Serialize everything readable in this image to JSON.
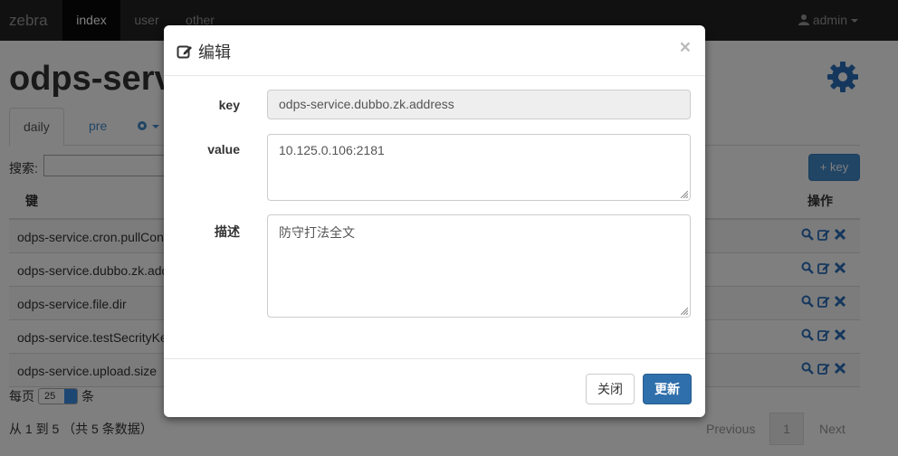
{
  "navbar": {
    "brand": "zebra",
    "items": [
      {
        "label": "index",
        "active": true
      },
      {
        "label": "user",
        "active": false
      },
      {
        "label": "other",
        "active": false
      }
    ],
    "user": "admin"
  },
  "page": {
    "title": "odps-service",
    "tabs": [
      "daily",
      "pre"
    ],
    "search_label": "搜索:",
    "add_key_label": "+ key",
    "columns": {
      "key": "键",
      "actions": "操作"
    },
    "rows": [
      "odps-service.cron.pullConfig",
      "odps-service.dubbo.zk.address",
      "odps-service.file.dir",
      "odps-service.testSecrityKey",
      "odps-service.upload.size"
    ],
    "per_page_prefix": "每页",
    "per_page_value": "25",
    "per_page_suffix": "条",
    "summary": "从 1 到 5 （共 5 条数据）",
    "pager": {
      "previous": "Previous",
      "current": "1",
      "next": "Next"
    }
  },
  "modal": {
    "title": "编辑",
    "close": "×",
    "key_label": "key",
    "key_value": "odps-service.dubbo.zk.address",
    "value_label": "value",
    "value_value": "10.125.0.106:2181",
    "desc_label": "描述",
    "desc_value": "防守打法全文",
    "cancel_label": "关闭",
    "save_label": "更新"
  },
  "colors": {
    "navbar": "#222222",
    "link": "#428bca",
    "primary": "#2f6fab",
    "overlay": "rgba(0,0,0,0.5)"
  }
}
